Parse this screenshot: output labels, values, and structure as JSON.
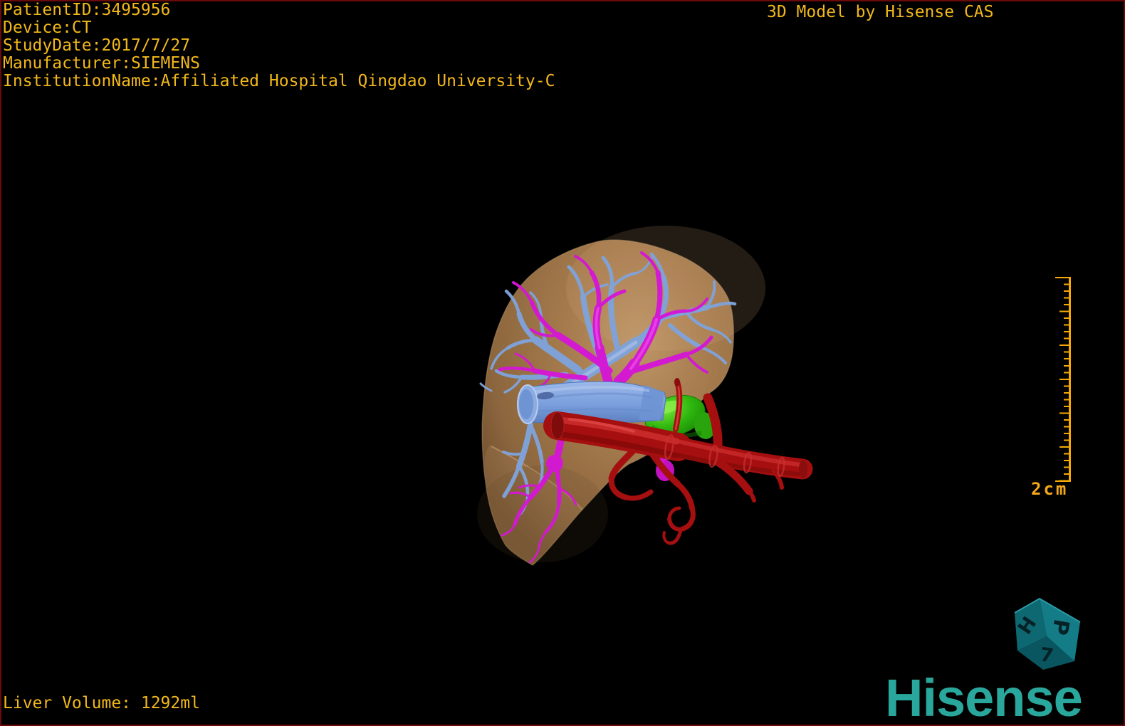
{
  "patient_overlay": {
    "lines": [
      "PatientID:3495956",
      "Device:CT",
      "StudyDate:2017/7/27",
      "Manufacturer:SIEMENS",
      "InstitutionName:Affiliated Hospital Qingdao University-C"
    ]
  },
  "watermark": {
    "text": "3D Model by Hisense CAS"
  },
  "measurements": {
    "scale_label": "2cm",
    "liver_volume": "Liver Volume: 1292ml"
  },
  "branding": {
    "logo_text": "Hisense",
    "logo_color": "#2aa79c"
  },
  "orientation_cube": {
    "faces": [
      {
        "label": "H"
      },
      {
        "label": "P"
      },
      {
        "label": "7"
      }
    ]
  },
  "colors": {
    "overlay_text": "#f2b81b",
    "ruler": "#f7ab00",
    "background": "#000000",
    "frame_border": "#6b0a0a",
    "liver": "#ab7f50",
    "hepatic_vein": "#7fa3db",
    "portal_vein": "#d517d5",
    "inferior_vena_cava": "#7ba2de",
    "hepatic_artery": "#a50f0f",
    "gallbladder": "#2db50e",
    "cube_face": "#137c87"
  },
  "model": {
    "structures": [
      {
        "name": "liver",
        "color": "#ab7f50"
      },
      {
        "name": "hepatic-vein-tree",
        "color": "#7fa3db"
      },
      {
        "name": "portal-vein-tree",
        "color": "#d517d5"
      },
      {
        "name": "inferior-vena-cava",
        "color": "#7ba2de"
      },
      {
        "name": "gallbladder",
        "color": "#2db50e"
      },
      {
        "name": "hepatic-artery",
        "color": "#a50f0f"
      }
    ]
  }
}
